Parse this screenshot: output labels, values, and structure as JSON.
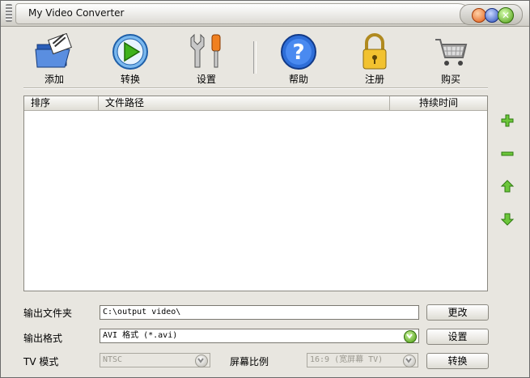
{
  "window": {
    "title": "My Video Converter"
  },
  "toolbar": {
    "items": [
      {
        "label": "添加",
        "icon": "folder-add-icon"
      },
      {
        "label": "转换",
        "icon": "play-icon"
      },
      {
        "label": "设置",
        "icon": "tools-icon"
      },
      {
        "label": "帮助",
        "icon": "help-icon"
      },
      {
        "label": "注册",
        "icon": "lock-icon"
      },
      {
        "label": "购买",
        "icon": "cart-icon"
      }
    ]
  },
  "file_list": {
    "columns": [
      "排序",
      "文件路径",
      "持续时间"
    ],
    "rows": []
  },
  "side_buttons": [
    "add-icon",
    "remove-icon",
    "move-up-icon",
    "move-down-icon"
  ],
  "output": {
    "folder_label": "输出文件夹",
    "folder_value": "C:\\output video\\",
    "change_button": "更改",
    "format_label": "输出格式",
    "format_value": "AVI 格式 (*.avi)",
    "settings_button": "设置",
    "tv_label": "TV 模式",
    "tv_value": "NTSC",
    "aspect_label": "屏幕比例",
    "aspect_value": "16:9  (宽屏幕 TV)",
    "convert_button": "转换"
  },
  "colors": {
    "accent_green": "#4a9a10",
    "title_bg": "#dcdad4"
  }
}
